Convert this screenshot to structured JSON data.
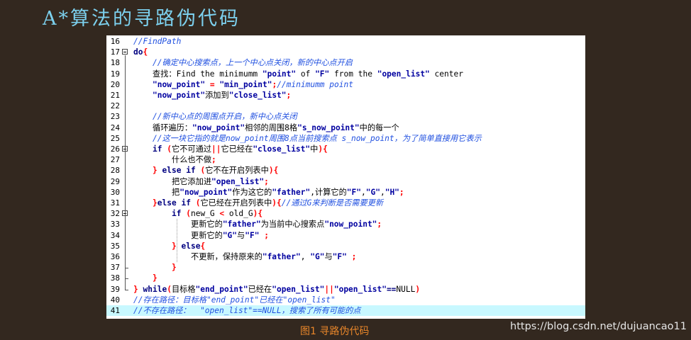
{
  "slide": {
    "title": "A*算法的寻路伪代码",
    "caption": "图1 寻路伪代码",
    "watermark": "https://blog.csdn.net/dujuancao11"
  },
  "colors": {
    "background": "#33281f",
    "title": "#7cd0ee",
    "caption": "#e8862a",
    "highlight_line": "#c8f8ff"
  },
  "editor": {
    "lines": [
      {
        "n": "16",
        "t": "//FindPath"
      },
      {
        "n": "17",
        "t": "do{"
      },
      {
        "n": "18",
        "t": "    //确定中心搜索点，上一个中心点关闭，新的中心点开启"
      },
      {
        "n": "19",
        "t": "    查找：Find the minimumm \"point\" of \"F\" from the \"open_list\" center"
      },
      {
        "n": "20",
        "t": "    \"now_point\" = \"min_point\";//minimumm point"
      },
      {
        "n": "21",
        "t": "    \"now_point\"添加到\"close_list\";"
      },
      {
        "n": "22",
        "t": ""
      },
      {
        "n": "23",
        "t": "    //新中心点的周围点开启，新中心点关闭"
      },
      {
        "n": "24",
        "t": "    循环遍历：\"now_point\"相邻的周围8格\"s_now_point\"中的每一个"
      },
      {
        "n": "25",
        "t": "    //这一块它指的就是now_point周围8点当前搜索点 s_now_point，为了简单直接用它表示"
      },
      {
        "n": "26",
        "t": "    if (它不可通过||它已经在\"close_list\"中){"
      },
      {
        "n": "27",
        "t": "        什么也不做;"
      },
      {
        "n": "28",
        "t": "    } else if (它不在开启列表中){"
      },
      {
        "n": "29",
        "t": "        把它添加进\"open_list\";"
      },
      {
        "n": "30",
        "t": "        把\"now_point\"作为这它的\"father\",计算它的\"F\",\"G\",\"H\";"
      },
      {
        "n": "31",
        "t": "    }else if (它已经在开启列表中){//通过G来判断是否需要更新"
      },
      {
        "n": "32",
        "t": "        if (new_G < old_G){"
      },
      {
        "n": "33",
        "t": "            更新它的\"father\"为当前中心搜索点\"now_point\";"
      },
      {
        "n": "34",
        "t": "            更新它的\"G\"与\"F\" ;"
      },
      {
        "n": "35",
        "t": "        } else{"
      },
      {
        "n": "36",
        "t": "            不更新，保持原来的\"father\", \"G\"与\"F\" ;"
      },
      {
        "n": "37",
        "t": "        }"
      },
      {
        "n": "38",
        "t": "    }"
      },
      {
        "n": "39",
        "t": "} while(目标格\"end_point\"已经在\"open_list\"||\"open_list\"==NULL)"
      },
      {
        "n": "40",
        "t": "//存在路径：目标格\"end_point\"已经在\"open_list\""
      },
      {
        "n": "41",
        "t": "//不存在路径：  \"open_list\"==NULL，搜索了所有可能的点"
      }
    ]
  }
}
